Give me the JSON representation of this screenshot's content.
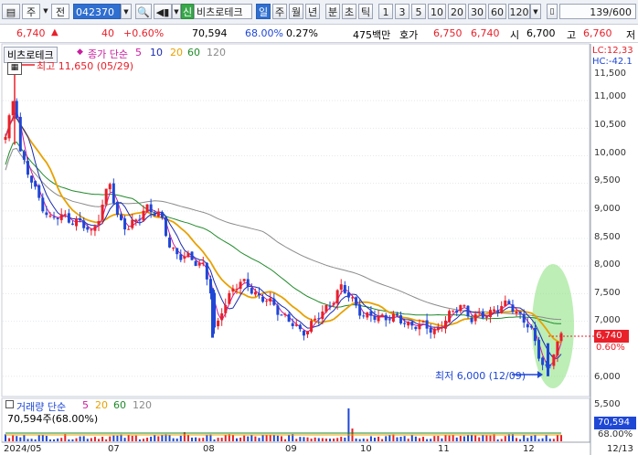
{
  "toolbar": {
    "market": "주",
    "type_label": "전",
    "code": "042370",
    "new_badge": "신",
    "stock_name": "비츠로테크",
    "periods": [
      "일",
      "주",
      "월",
      "년",
      "분",
      "초",
      "틱"
    ],
    "active_period": "일",
    "intervals": [
      "1",
      "3",
      "5",
      "10",
      "20",
      "30",
      "60",
      "120"
    ],
    "page_count": "139/600"
  },
  "quote": {
    "price": "6,740",
    "arrow": "▲",
    "change": "40",
    "change_pct": "+0.60%",
    "volume": "70,594",
    "vol_ratio": "68.00%",
    "turnover": "0.27%",
    "trade_value": "475백만",
    "ask_label": "호가",
    "ask": "6,750",
    "bid": "6,740",
    "open_label": "시",
    "open": "6,700",
    "high_label": "고",
    "high": "6,760",
    "rest_label": "저"
  },
  "price_panel": {
    "stock_tag": "비츠로테크",
    "ma_legend_title": "종가 단순",
    "ma_periods": [
      "5",
      "10",
      "20",
      "60",
      "120"
    ],
    "ma_colors": [
      "#c81e9e",
      "#1a2bb0",
      "#e8a100",
      "#1e8a28",
      "#8a8a8a"
    ],
    "high_note": "최고 11,650 (05/29)",
    "low_note": "최저 6,000 (12/09)",
    "lc_label": "LC:12,33",
    "hc_label": "HC:-42.1",
    "y_ticks": [
      "11,500",
      "11,000",
      "10,500",
      "10,000",
      "9,500",
      "9,000",
      "8,500",
      "8,000",
      "7,500",
      "7,000",
      "6,500",
      "6,000",
      "5,500"
    ],
    "price_box": "6,740",
    "pct_box": "0.60%"
  },
  "volume_panel": {
    "title": "거래량 단순",
    "ma_periods": [
      "5",
      "20",
      "60",
      "120"
    ],
    "value_note": "70,594주(68.00%)",
    "box_value": "70,594",
    "box_pct": "68.00%"
  },
  "x_labels": [
    "2024/05",
    "07",
    "08",
    "09",
    "10",
    "11",
    "12",
    "12/13"
  ],
  "colors": {
    "up": "#e8202a",
    "down": "#1f47d6",
    "highlight": "#86e07a",
    "accent": "#2f6fd0"
  }
}
